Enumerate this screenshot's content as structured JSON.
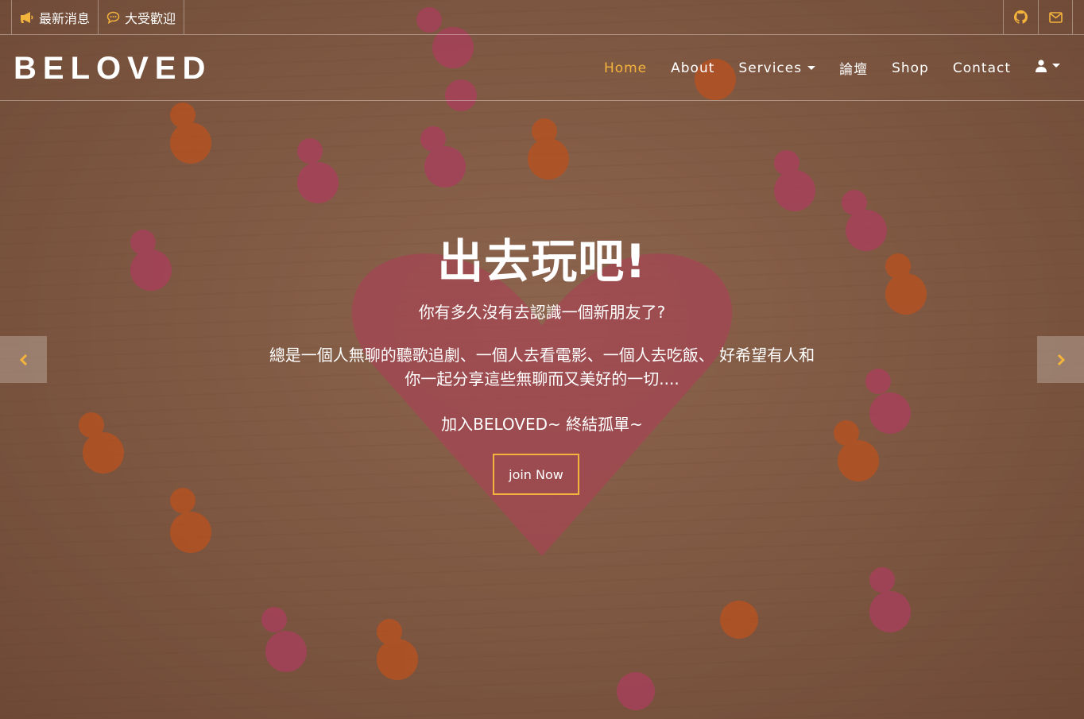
{
  "topbar": {
    "news": {
      "label": "最新消息",
      "icon": "megaphone-icon"
    },
    "popular": {
      "label": "大受歡迎",
      "icon": "chat-bubble-icon"
    },
    "github_icon": "github-icon",
    "mail_icon": "envelope-icon"
  },
  "navbar": {
    "brand": "BELOVED",
    "links": [
      {
        "label": "Home",
        "active": true
      },
      {
        "label": "About"
      },
      {
        "label": "Services",
        "dropdown": true
      },
      {
        "label": "論壇"
      },
      {
        "label": "Shop"
      },
      {
        "label": "Contact"
      }
    ],
    "user_icon": "user-icon"
  },
  "hero": {
    "title": "出去玩吧!",
    "line1": "你有多久沒有去認識一個新朋友了?",
    "line2": "總是一個人無聊的聽歌追劇、一個人去看電影、一個人去吃飯、 好希望有人和你一起分享這些無聊而又美好的一切....",
    "line3": "加入BELOVED~ 終結孤單~",
    "cta": "join Now"
  },
  "carousel": {
    "prev_icon": "chevron-left-icon",
    "next_icon": "chevron-right-icon"
  },
  "colors": {
    "accent": "#f4b33c",
    "text": "#ffffff"
  }
}
